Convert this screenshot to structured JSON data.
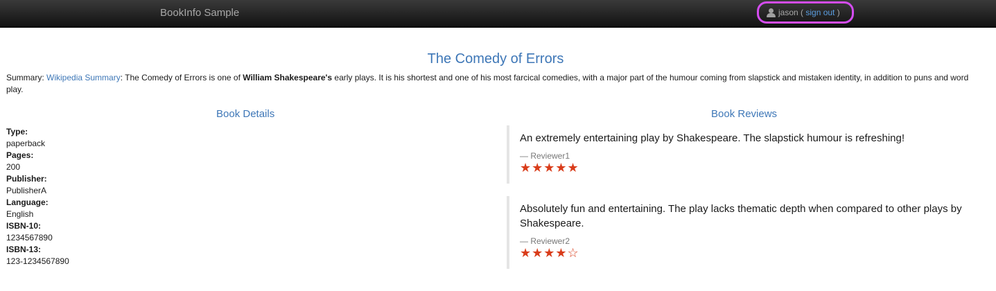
{
  "navbar": {
    "brand": "BookInfo Sample",
    "user_name": "jason",
    "open_paren": " ( ",
    "sign_out": "sign out",
    "close_paren": " )"
  },
  "book": {
    "title": "The Comedy of Errors",
    "summary_label": "Summary: ",
    "summary_link": "Wikipedia Summary",
    "summary_pre": ": The Comedy of Errors is one of ",
    "summary_bold": "William Shakespeare's",
    "summary_post": " early plays. It is his shortest and one of his most farcical comedies, with a major part of the humour coming from slapstick and mistaken identity, in addition to puns and word play."
  },
  "details": {
    "heading": "Book Details",
    "fields": [
      {
        "label": "Type:",
        "value": "paperback"
      },
      {
        "label": "Pages:",
        "value": "200"
      },
      {
        "label": "Publisher:",
        "value": "PublisherA"
      },
      {
        "label": "Language:",
        "value": "English"
      },
      {
        "label": "ISBN-10:",
        "value": "1234567890"
      },
      {
        "label": "ISBN-13:",
        "value": "123-1234567890"
      }
    ]
  },
  "reviews": {
    "heading": "Book Reviews",
    "items": [
      {
        "text": "An extremely entertaining play by Shakespeare. The slapstick humour is refreshing!",
        "reviewer": "— Reviewer1",
        "stars": "★★★★★",
        "rating": 5
      },
      {
        "text": "Absolutely fun and entertaining. The play lacks thematic depth when compared to other plays by Shakespeare.",
        "reviewer": "— Reviewer2",
        "stars": "★★★★☆",
        "rating": 4
      }
    ]
  },
  "colors": {
    "link": "#3e77b7",
    "star": "#d93c1a",
    "highlight": "#d44cf0"
  }
}
